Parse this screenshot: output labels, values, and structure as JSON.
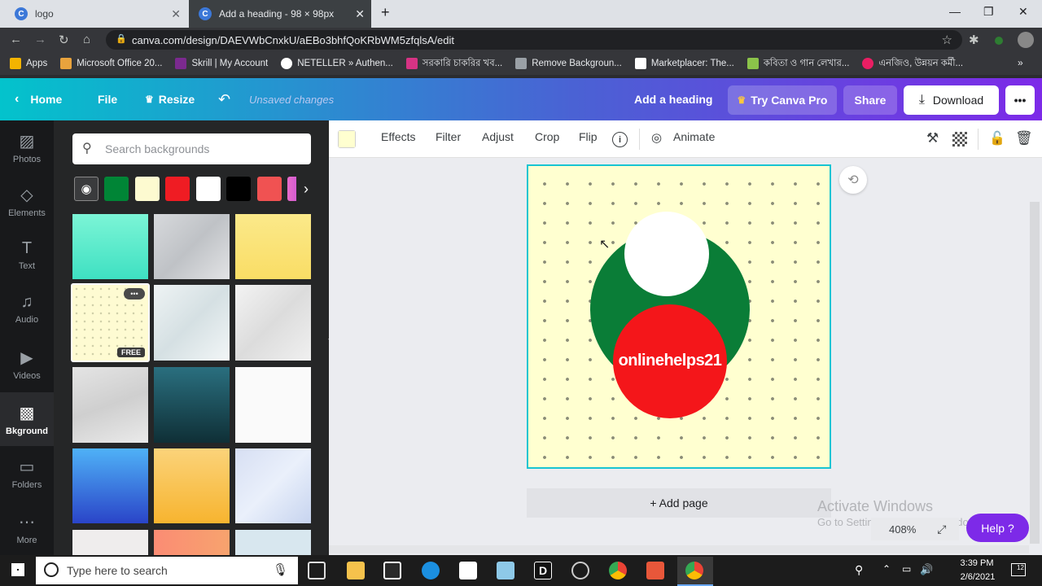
{
  "browser": {
    "tabs": [
      {
        "title": "logo",
        "favicon": "C"
      },
      {
        "title": "Add a heading - 98 × 98px",
        "favicon": "C"
      }
    ],
    "url": "canva.com/design/DAEVWbCnxkU/aEBo3bhfQoKRbWM5zfqlsA/edit",
    "bookmarks": [
      {
        "label": "Apps",
        "color": "#f4b400"
      },
      {
        "label": "Microsoft Office 20...",
        "color": "#e8a33d"
      },
      {
        "label": "Skrill | My Account",
        "color": "#7b2a8f"
      },
      {
        "label": "NETELLER » Authen...",
        "color": "#ffffff"
      },
      {
        "label": "সরকারি চাকরির খব...",
        "color": "#d63384"
      },
      {
        "label": "Remove Backgroun...",
        "color": "#9aa0a6"
      },
      {
        "label": "Marketplacer: The...",
        "color": "#ffffff"
      },
      {
        "label": "কবিতা ও গান লেখার...",
        "color": "#8bc34a"
      },
      {
        "label": "এনজিও, উন্নয়ন কর্মী...",
        "color": "#e91e63"
      }
    ]
  },
  "header": {
    "home": "Home",
    "file": "File",
    "resize": "Resize",
    "unsaved": "Unsaved changes",
    "design_title": "Add a heading",
    "try_pro": "Try Canva Pro",
    "share": "Share",
    "download": "Download",
    "more": "•••"
  },
  "rail": [
    {
      "label": "Photos",
      "icon": "image-icon"
    },
    {
      "label": "Elements",
      "icon": "shapes-icon"
    },
    {
      "label": "Text",
      "icon": "text-icon"
    },
    {
      "label": "Audio",
      "icon": "music-icon"
    },
    {
      "label": "Videos",
      "icon": "video-icon"
    },
    {
      "label": "Bkground",
      "icon": "pattern-icon"
    },
    {
      "label": "Folders",
      "icon": "folder-icon"
    },
    {
      "label": "More",
      "icon": "more-icon"
    }
  ],
  "panel": {
    "search_placeholder": "Search backgrounds",
    "swatches": [
      "#008536",
      "#fdfad0",
      "#ef1c23",
      "#ffffff",
      "#000000",
      "#f05252"
    ],
    "free_badge": "FREE",
    "thumb_menu": "•••"
  },
  "toolbar": {
    "swatch_color": "#ffffd0",
    "effects": "Effects",
    "filter": "Filter",
    "adjust": "Adjust",
    "crop": "Crop",
    "flip": "Flip",
    "animate": "Animate"
  },
  "canvas": {
    "background": "#ffffd0",
    "logo_text": "onlinehelps21",
    "green": "#0a7d37",
    "red": "#f4161a",
    "white": "#ffffff"
  },
  "footer": {
    "add_page": "+ Add page",
    "zoom": "408%",
    "help": "Help ?",
    "activate_title": "Activate Windows",
    "activate_sub": "Go to Settings to activate Windows."
  },
  "taskbar": {
    "search_placeholder": "Type here to search",
    "time": "3:39 PM",
    "date": "2/6/2021",
    "notifications": "12"
  }
}
